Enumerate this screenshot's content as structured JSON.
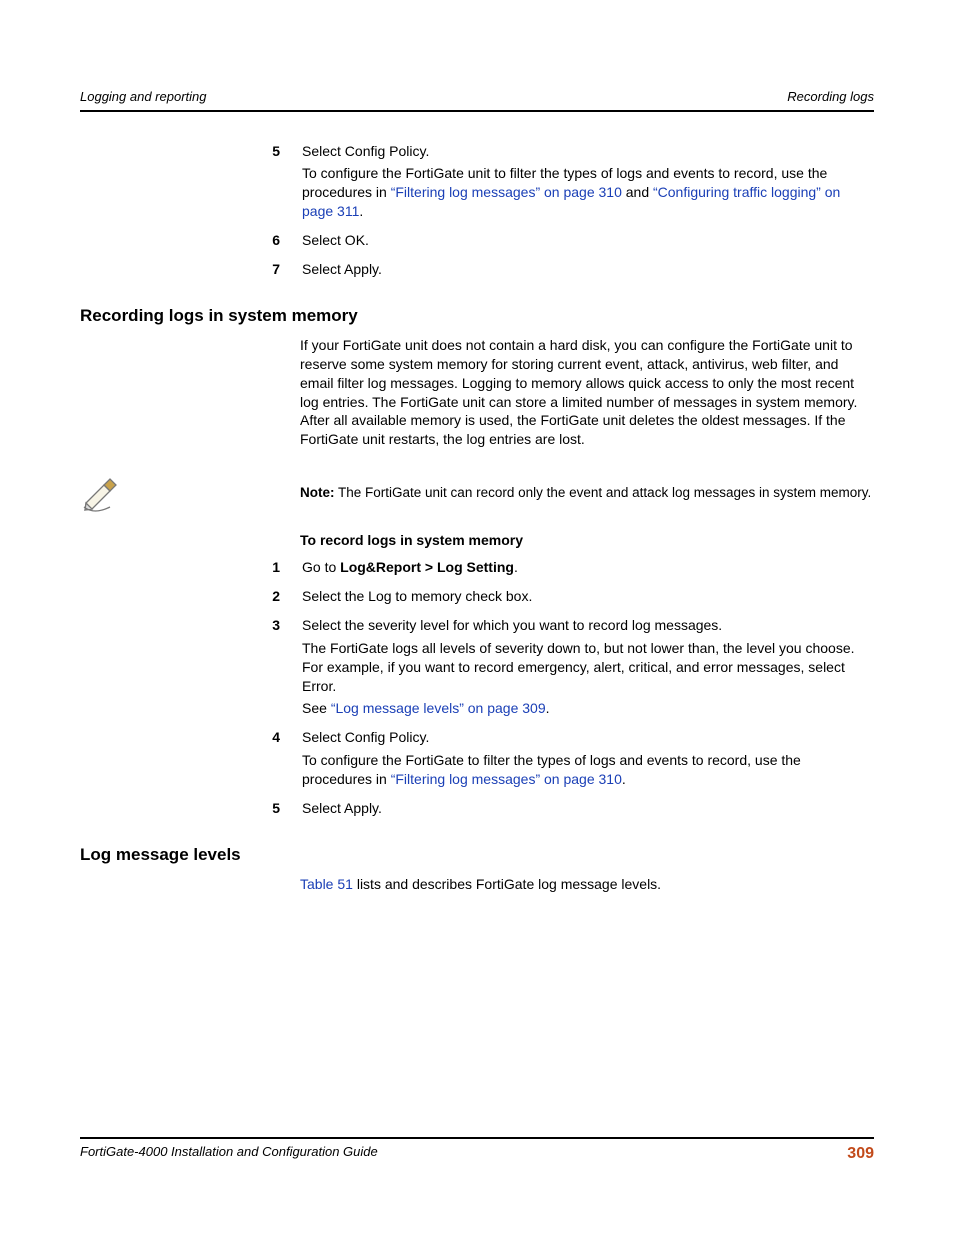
{
  "header": {
    "left": "Logging and reporting",
    "right": "Recording logs"
  },
  "top_steps": {
    "s5": {
      "label": "5",
      "p1": "Select Config Policy.",
      "p2a": "To configure the FortiGate unit to filter the types of logs and events to record, use the procedures in ",
      "link1": "“Filtering log messages” on page 310",
      "mid": " and ",
      "link2": "“Configuring traffic logging” on page 311",
      "end": "."
    },
    "s6": {
      "label": "6",
      "text": "Select OK."
    },
    "s7": {
      "label": "7",
      "text": "Select Apply."
    }
  },
  "rec_section": {
    "heading": "Recording logs in system memory",
    "body": "If your FortiGate unit does not contain a hard disk, you can configure the FortiGate unit to reserve some system memory for storing current event, attack, antivirus, web filter, and email filter log messages. Logging to memory allows quick access to only the most recent log entries. The FortiGate unit can store a limited number of messages in system memory. After all available memory is used, the FortiGate unit deletes the oldest messages. If the FortiGate unit restarts, the log entries are lost."
  },
  "note": {
    "label": "Note:",
    "text": " The FortiGate unit can record only the event and attack log messages in system memory."
  },
  "proc": {
    "heading": "To record logs in system memory",
    "s1": {
      "label": "1",
      "pre": "Go to ",
      "bold": "Log&Report > Log Setting",
      "post": "."
    },
    "s2": {
      "label": "2",
      "text": "Select the Log to memory check box."
    },
    "s3": {
      "label": "3",
      "p1": "Select the severity level for which you want to record log messages.",
      "p2": "The FortiGate logs all levels of severity down to, but not lower than, the level you choose. For example, if you want to record emergency, alert, critical, and error messages, select Error.",
      "p3a": "See ",
      "link": "“Log message levels” on page 309",
      "p3b": "."
    },
    "s4": {
      "label": "4",
      "p1": "Select Config Policy.",
      "p2a": "To configure the FortiGate to filter the types of logs and events to record, use the procedures in ",
      "link": "“Filtering log messages” on page 310",
      "p2b": "."
    },
    "s5": {
      "label": "5",
      "text": "Select Apply."
    }
  },
  "levels_section": {
    "heading": "Log message levels",
    "body_pre_link": "Table 51",
    "body_post": " lists and describes FortiGate log message levels."
  },
  "footer": {
    "title": "FortiGate-4000 Installation and Configuration Guide",
    "page": "309"
  }
}
